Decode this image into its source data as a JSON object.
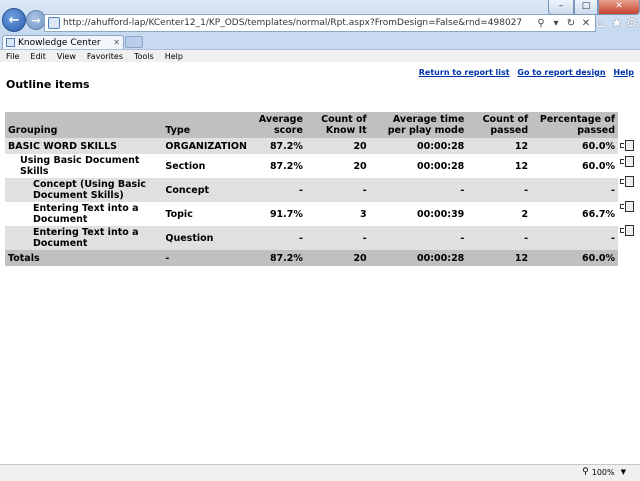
{
  "browser": {
    "url": "http://ahufford-lap/KCenter12_1/KP_ODS/templates/normal/Rpt.aspx?FromDesign=False&rnd=498027",
    "tab_title": "Knowledge Center",
    "menu": [
      "File",
      "Edit",
      "View",
      "Favorites",
      "Tools",
      "Help"
    ],
    "zoom": "100%"
  },
  "links": {
    "return": "Return to report list",
    "design": "Go to report design",
    "help": "Help"
  },
  "page_title": "Outline items",
  "table": {
    "headers": [
      "Grouping",
      "Type",
      "Average score",
      "Count of Know It",
      "Average time per play mode",
      "Count of passed",
      "Percentage of passed"
    ],
    "rows": [
      {
        "grouping": "BASIC WORD SKILLS",
        "type": "ORGANIZATION",
        "avg_score": "87.2%",
        "know_it": "20",
        "avg_time": "00:00:28",
        "passed": "12",
        "pct_passed": "60.0%"
      },
      {
        "grouping": "Using Basic Document Skills",
        "type": "Section",
        "avg_score": "87.2%",
        "know_it": "20",
        "avg_time": "00:00:28",
        "passed": "12",
        "pct_passed": "60.0%"
      },
      {
        "grouping": "Concept (Using Basic Document Skills)",
        "type": "Concept",
        "avg_score": "-",
        "know_it": "-",
        "avg_time": "-",
        "passed": "-",
        "pct_passed": "-"
      },
      {
        "grouping": "Entering Text into a Document",
        "type": "Topic",
        "avg_score": "91.7%",
        "know_it": "3",
        "avg_time": "00:00:39",
        "passed": "2",
        "pct_passed": "66.7%"
      },
      {
        "grouping": "Entering Text into a Document",
        "type": "Question",
        "avg_score": "-",
        "know_it": "-",
        "avg_time": "-",
        "passed": "-",
        "pct_passed": "-"
      }
    ],
    "totals": {
      "label": "Totals",
      "type": "-",
      "avg_score": "87.2%",
      "know_it": "20",
      "avg_time": "00:00:28",
      "passed": "12",
      "pct_passed": "60.0%"
    }
  }
}
